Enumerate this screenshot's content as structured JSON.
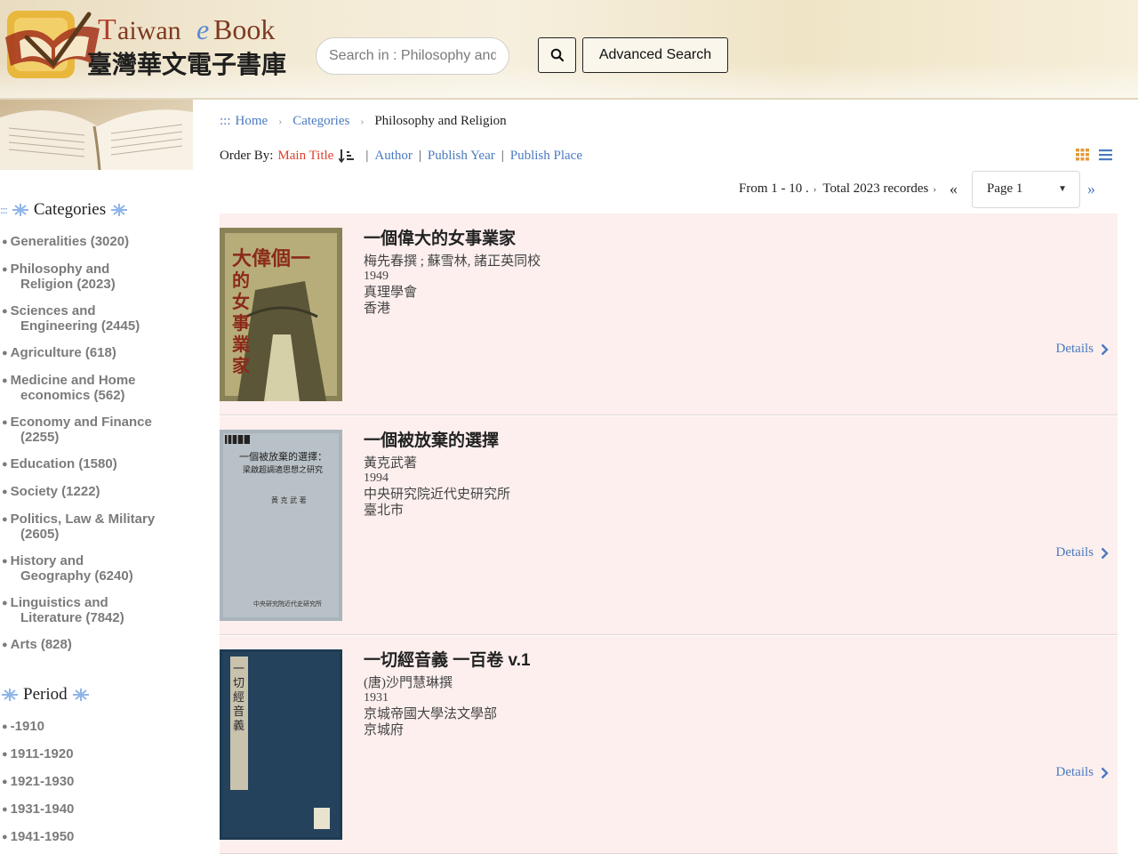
{
  "header": {
    "logo_text_en": "Taiwan eBook",
    "logo_text_zh": "臺灣華文電子書庫",
    "search_placeholder": "Search in : Philosophy and Religion",
    "advanced_search_label": "Advanced Search"
  },
  "sidebar": {
    "categories_heading": "Categories",
    "categories": [
      {
        "label": "Generalities (3020)"
      },
      {
        "label": "Philosophy and",
        "cont": "Religion (2023)"
      },
      {
        "label": "Sciences and",
        "cont": "Engineering (2445)"
      },
      {
        "label": "Agriculture (618)"
      },
      {
        "label": "Medicine and Home",
        "cont": "economics (562)"
      },
      {
        "label": "Economy and Finance",
        "cont": "(2255)"
      },
      {
        "label": "Education (1580)"
      },
      {
        "label": "Society (1222)"
      },
      {
        "label": "Politics, Law & Military",
        "cont": "(2605)"
      },
      {
        "label": "History and",
        "cont": "Geography (6240)"
      },
      {
        "label": "Linguistics and",
        "cont": "Literature (7842)"
      },
      {
        "label": "Arts (828)"
      }
    ],
    "period_heading": "Period",
    "periods": [
      {
        "label": "-1910"
      },
      {
        "label": "1911-1920"
      },
      {
        "label": "1921-1930"
      },
      {
        "label": "1931-1940"
      },
      {
        "label": "1941-1950"
      }
    ]
  },
  "breadcrumb": {
    "prefix": ":::",
    "home": "Home",
    "categories": "Categories",
    "current": "Philosophy and Religion"
  },
  "order_by": {
    "label": "Order By:",
    "main_title": "Main Title",
    "author": "Author",
    "publish_year": "Publish Year",
    "publish_place": "Publish Place"
  },
  "pager": {
    "range_text": "From 1 - 10 .",
    "total_text": "Total 2023 recordes",
    "page_value": "Page 1"
  },
  "results": [
    {
      "title": "一個偉大的女事業家",
      "author": "梅先春撰 ; 蘇雪林, 諸正英同校",
      "year": "1949",
      "publisher": "真理學會",
      "place": "香港",
      "details_label": "Details"
    },
    {
      "title": "一個被放棄的選擇",
      "author": "黃克武著",
      "year": "1994",
      "publisher": "中央研究院近代史研究所",
      "place": "臺北市",
      "details_label": "Details"
    },
    {
      "title": "一切經音義 一百卷 v.1",
      "author": "(唐)沙門慧琳撰",
      "year": "1931",
      "publisher": "京城帝國大學法文學部",
      "place": "京城府",
      "details_label": "Details"
    }
  ],
  "colors": {
    "link": "#4a7abf",
    "active_sort": "#e0402c",
    "result_bg": "#fcefee",
    "sidebar_text": "#7b7b7b"
  }
}
